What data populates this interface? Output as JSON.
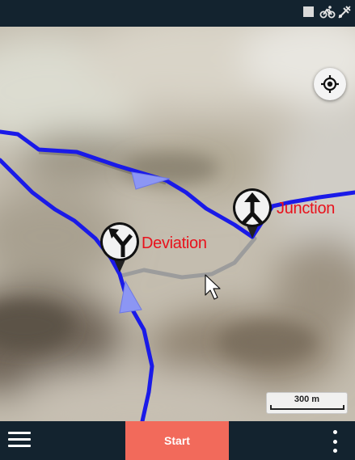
{
  "status_bar": {
    "icons": [
      "square-icon",
      "bicycle-icon",
      "gps-off-icon"
    ]
  },
  "map": {
    "pois": [
      {
        "label": "Deviation",
        "icon": "fork-left-icon"
      },
      {
        "label": "Junction",
        "icon": "merge-up-icon"
      }
    ],
    "scale_label": "300 m",
    "colors": {
      "route": "#1b1bdd",
      "deviation_route": "#a8a8a8",
      "direction_arrow": "#8c95f2",
      "poi_label": "#e8121c"
    }
  },
  "bottom_bar": {
    "start_label": "Start"
  }
}
